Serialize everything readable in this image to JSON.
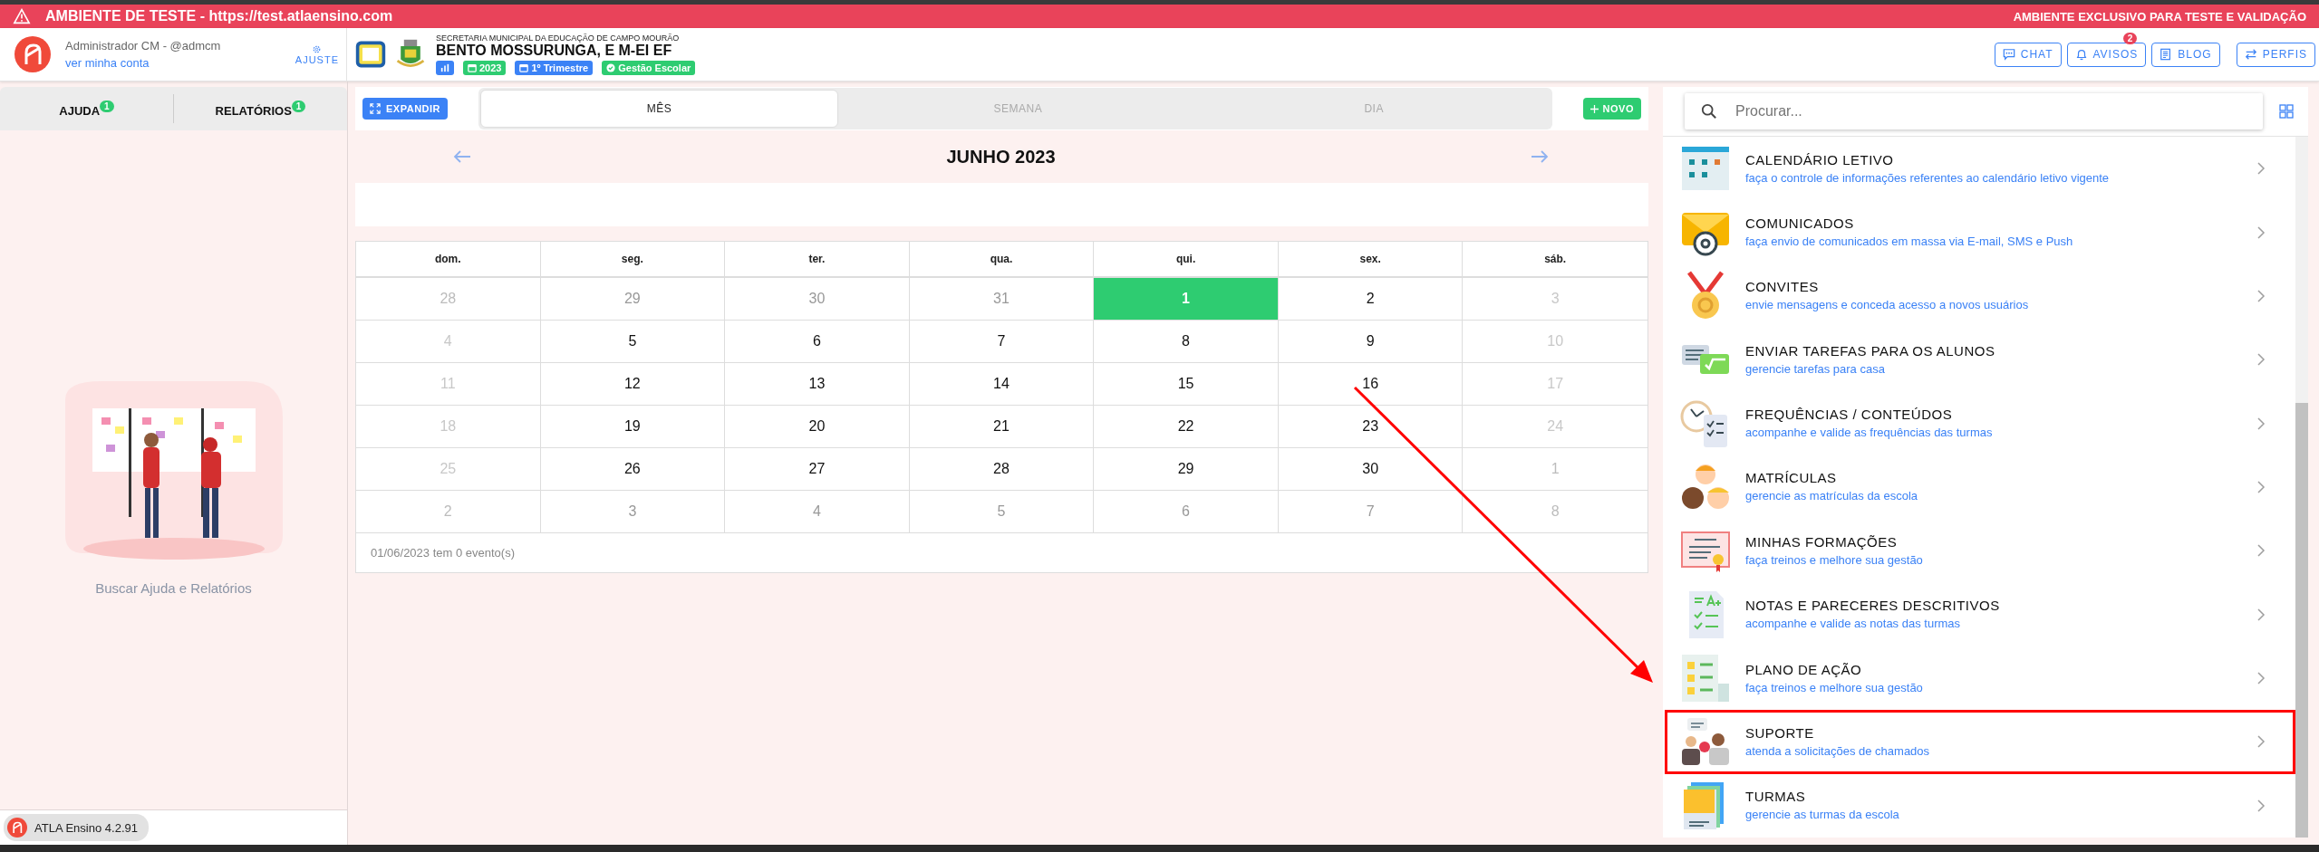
{
  "test_banner": {
    "text": "AMBIENTE DE TESTE - https://test.atlaensino.com",
    "notice": "AMBIENTE EXCLUSIVO PARA TESTE E VALIDAÇÃO"
  },
  "user": {
    "name": "Administrador CM - @admcm",
    "account_link": "ver minha conta",
    "settings": "AJUSTE"
  },
  "school": {
    "secretariat": "SECRETARIA MUNICIPAL DA EDUCAÇÃO DE CAMPO MOURÃO",
    "name": "BENTO MOSSURUNGA, E M-EI EF",
    "badges": [
      {
        "kind": "chart",
        "color": "#3b82f6"
      },
      {
        "kind": "calendar",
        "label": "2023",
        "color": "#2ecc71"
      },
      {
        "kind": "calendar",
        "label": "1º Trimestre",
        "color": "#3b82f6"
      },
      {
        "kind": "check",
        "label": "Gestão Escolar",
        "color": "#2ecc71"
      }
    ]
  },
  "header_buttons": [
    {
      "kind": "chat",
      "label": "CHAT"
    },
    {
      "kind": "bell",
      "label": "AVISOS",
      "badge": "2"
    },
    {
      "kind": "news",
      "label": "BLOG"
    },
    {
      "kind": "swap",
      "label": "PERFIS"
    }
  ],
  "left_tabs": [
    {
      "label": "AJUDA",
      "count": "1"
    },
    {
      "label": "RELATÓRIOS",
      "count": "1"
    }
  ],
  "help_empty": {
    "caption": "Buscar Ajuda e Relatórios"
  },
  "version": "ATLA Ensino 4.2.91",
  "calendar": {
    "expand": "EXPANDIR",
    "views": [
      {
        "label": "MÊS",
        "selected": true
      },
      {
        "label": "SEMANA",
        "selected": false
      },
      {
        "label": "DIA",
        "selected": false
      }
    ],
    "new": "NOVO",
    "title": "JUNHO 2023",
    "weekdays": [
      "dom.",
      "seg.",
      "ter.",
      "qua.",
      "qui.",
      "sex.",
      "sáb."
    ],
    "weeks": [
      [
        {
          "day": "28",
          "outside_month": true,
          "selected": false
        },
        {
          "day": "29",
          "outside_month": true,
          "selected": false
        },
        {
          "day": "30",
          "outside_month": true,
          "selected": false
        },
        {
          "day": "31",
          "outside_month": true,
          "selected": false
        },
        {
          "day": "1",
          "outside_month": false,
          "selected": true
        },
        {
          "day": "2",
          "outside_month": false,
          "selected": false
        },
        {
          "day": "3",
          "outside_month": false,
          "selected": false
        }
      ],
      [
        {
          "day": "4",
          "outside_month": false,
          "selected": false
        },
        {
          "day": "5",
          "outside_month": false,
          "selected": false
        },
        {
          "day": "6",
          "outside_month": false,
          "selected": false
        },
        {
          "day": "7",
          "outside_month": false,
          "selected": false
        },
        {
          "day": "8",
          "outside_month": false,
          "selected": false
        },
        {
          "day": "9",
          "outside_month": false,
          "selected": false
        },
        {
          "day": "10",
          "outside_month": false,
          "selected": false
        }
      ],
      [
        {
          "day": "11",
          "outside_month": false,
          "selected": false
        },
        {
          "day": "12",
          "outside_month": false,
          "selected": false
        },
        {
          "day": "13",
          "outside_month": false,
          "selected": false
        },
        {
          "day": "14",
          "outside_month": false,
          "selected": false
        },
        {
          "day": "15",
          "outside_month": false,
          "selected": false
        },
        {
          "day": "16",
          "outside_month": false,
          "selected": false
        },
        {
          "day": "17",
          "outside_month": false,
          "selected": false
        }
      ],
      [
        {
          "day": "18",
          "outside_month": false,
          "selected": false
        },
        {
          "day": "19",
          "outside_month": false,
          "selected": false
        },
        {
          "day": "20",
          "outside_month": false,
          "selected": false
        },
        {
          "day": "21",
          "outside_month": false,
          "selected": false
        },
        {
          "day": "22",
          "outside_month": false,
          "selected": false
        },
        {
          "day": "23",
          "outside_month": false,
          "selected": false
        },
        {
          "day": "24",
          "outside_month": false,
          "selected": false
        }
      ],
      [
        {
          "day": "25",
          "outside_month": false,
          "selected": false
        },
        {
          "day": "26",
          "outside_month": false,
          "selected": false
        },
        {
          "day": "27",
          "outside_month": false,
          "selected": false
        },
        {
          "day": "28",
          "outside_month": false,
          "selected": false
        },
        {
          "day": "29",
          "outside_month": false,
          "selected": false
        },
        {
          "day": "30",
          "outside_month": false,
          "selected": false
        },
        {
          "day": "1",
          "outside_month": true,
          "selected": false
        }
      ],
      [
        {
          "day": "2",
          "outside_month": true,
          "selected": false
        },
        {
          "day": "3",
          "outside_month": true,
          "selected": false
        },
        {
          "day": "4",
          "outside_month": true,
          "selected": false
        },
        {
          "day": "5",
          "outside_month": true,
          "selected": false
        },
        {
          "day": "6",
          "outside_month": true,
          "selected": false
        },
        {
          "day": "7",
          "outside_month": true,
          "selected": false
        },
        {
          "day": "8",
          "outside_month": true,
          "selected": false
        }
      ]
    ],
    "footer": "01/06/2023 tem 0 evento(s)"
  },
  "search": {
    "placeholder": "Procurar..."
  },
  "modules": [
    {
      "title": "CALENDÁRIO LETIVO",
      "description": "faça o controle de informações referentes ao calendário letivo vigente",
      "highlighted": false
    },
    {
      "title": "COMUNICADOS",
      "description": "faça envio de comunicados em massa via E-mail, SMS e Push",
      "highlighted": false
    },
    {
      "title": "CONVITES",
      "description": "envie mensagens e conceda acesso a novos usuários",
      "highlighted": false
    },
    {
      "title": "ENVIAR TAREFAS PARA OS ALUNOS",
      "description": "gerencie tarefas para casa",
      "highlighted": false
    },
    {
      "title": "FREQUÊNCIAS / CONTEÚDOS",
      "description": "acompanhe e valide as frequências das turmas",
      "highlighted": false
    },
    {
      "title": "MATRÍCULAS",
      "description": "gerencie as matrículas da escola",
      "highlighted": false
    },
    {
      "title": "MINHAS FORMAÇÕES",
      "description": "faça treinos e melhore sua gestão",
      "highlighted": false
    },
    {
      "title": "NOTAS E PARECERES DESCRITIVOS",
      "description": "acompanhe e valide as notas das turmas",
      "highlighted": false
    },
    {
      "title": "PLANO DE AÇÃO",
      "description": "faça treinos e melhore sua gestão",
      "highlighted": false
    },
    {
      "title": "SUPORTE",
      "description": "atenda a solicitações de chamados",
      "highlighted": true
    },
    {
      "title": "TURMAS",
      "description": "gerencie as turmas da escola",
      "highlighted": false
    }
  ]
}
